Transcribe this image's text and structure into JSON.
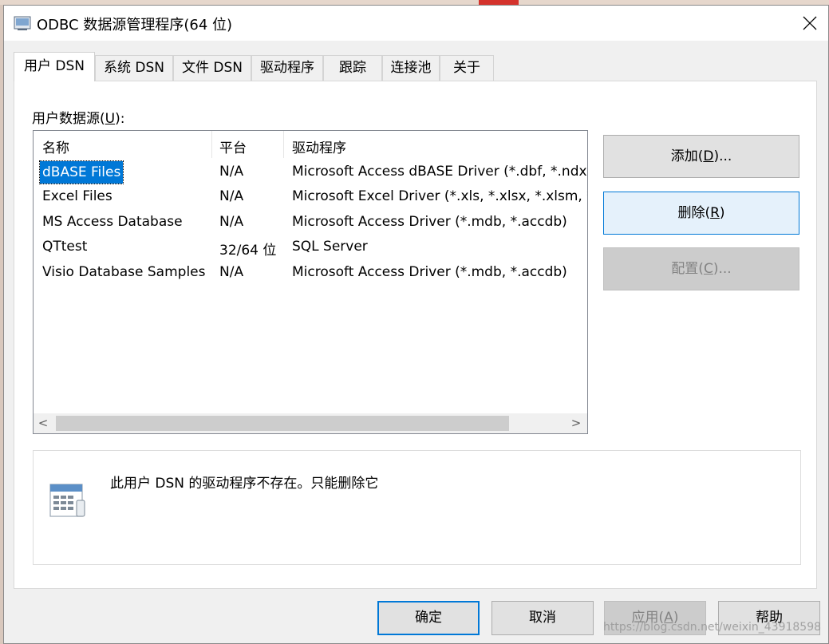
{
  "window": {
    "title": "ODBC 数据源管理程序(64 位)"
  },
  "tabs": [
    {
      "label": "用户 DSN",
      "active": true
    },
    {
      "label": "系统 DSN"
    },
    {
      "label": "文件 DSN"
    },
    {
      "label": "驱动程序"
    },
    {
      "label": "跟踪"
    },
    {
      "label": "连接池"
    },
    {
      "label": "关于"
    }
  ],
  "user_dsn": {
    "section_label_prefix": "用户数据源(",
    "section_label_key": "U",
    "section_label_suffix": "):",
    "columns": [
      "名称",
      "平台",
      "驱动程序"
    ],
    "rows": [
      {
        "name": "dBASE Files",
        "platform": "N/A",
        "driver": "Microsoft Access dBASE Driver (*.dbf, *.ndx, *.mdx)",
        "selected": true
      },
      {
        "name": "Excel Files",
        "platform": "N/A",
        "driver": "Microsoft Excel Driver (*.xls, *.xlsx, *.xlsm, *.xlsb)"
      },
      {
        "name": "MS Access Database",
        "platform": "N/A",
        "driver": "Microsoft Access Driver (*.mdb, *.accdb)"
      },
      {
        "name": "QTtest",
        "platform": "32/64 位",
        "driver": "SQL Server"
      },
      {
        "name": "Visio Database Samples",
        "platform": "N/A",
        "driver": "Microsoft Access Driver (*.mdb, *.accdb)"
      }
    ],
    "scroll_left": "<",
    "scroll_right": ">"
  },
  "side_buttons": {
    "add": {
      "prefix": "添加(",
      "key": "D",
      "suffix": ")..."
    },
    "remove": {
      "prefix": "删除(",
      "key": "R",
      "suffix": ")"
    },
    "configure": {
      "prefix": "配置(",
      "key": "C",
      "suffix": ")..."
    }
  },
  "message": {
    "text": "此用户 DSN 的驱动程序不存在。只能删除它",
    "icon": "database-document-icon"
  },
  "bottom_buttons": {
    "ok": "确定",
    "cancel": "取消",
    "apply_prefix": "应用(",
    "apply_key": "A",
    "apply_suffix": ")",
    "help": "帮助"
  },
  "watermark": "https://blog.csdn.net/weixin_43918598",
  "colors": {
    "selection": "#0078d7",
    "hover_button": "#e5f1fb"
  }
}
